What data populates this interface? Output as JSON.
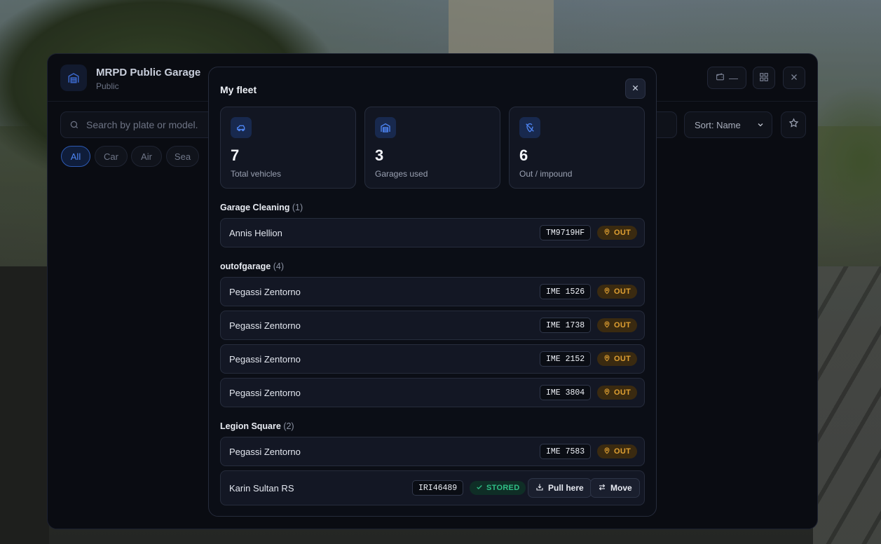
{
  "garage": {
    "title": "MRPD Public Garage",
    "subtitle": "Public",
    "wallet": "—",
    "search_placeholder": "Search by plate or model...",
    "sort_label": "Sort: Name",
    "filters": [
      "All",
      "Car",
      "Air",
      "Sea"
    ],
    "active_filter": "All"
  },
  "fleet": {
    "title": "My fleet",
    "stats": [
      {
        "value": "7",
        "label": "Total vehicles",
        "icon": "car-icon"
      },
      {
        "value": "3",
        "label": "Garages used",
        "icon": "garage-icon"
      },
      {
        "value": "6",
        "label": "Out / impound",
        "icon": "location-off-icon"
      }
    ],
    "groups": [
      {
        "name": "Garage Cleaning",
        "count": "(1)",
        "vehicles": [
          {
            "model": "Annis Hellion",
            "plate": "TM9719HF",
            "status": "OUT"
          }
        ]
      },
      {
        "name": "outofgarage",
        "count": "(4)",
        "vehicles": [
          {
            "model": "Pegassi Zentorno",
            "plate": "IME 1526",
            "status": "OUT"
          },
          {
            "model": "Pegassi Zentorno",
            "plate": "IME 1738",
            "status": "OUT"
          },
          {
            "model": "Pegassi Zentorno",
            "plate": "IME 2152",
            "status": "OUT"
          },
          {
            "model": "Pegassi Zentorno",
            "plate": "IME 3804",
            "status": "OUT"
          }
        ]
      },
      {
        "name": "Legion Square",
        "count": "(2)",
        "vehicles": [
          {
            "model": "Pegassi Zentorno",
            "plate": "IME 7583",
            "status": "OUT"
          },
          {
            "model": "Karin Sultan RS",
            "plate": "IRI46489",
            "status": "STORED",
            "actions": [
              "Pull here",
              "Move"
            ]
          }
        ]
      }
    ]
  },
  "colors": {
    "accent": "#4e86f5",
    "out": "#e0a032",
    "stored": "#2fbf86",
    "panel": "#0b0e16"
  }
}
